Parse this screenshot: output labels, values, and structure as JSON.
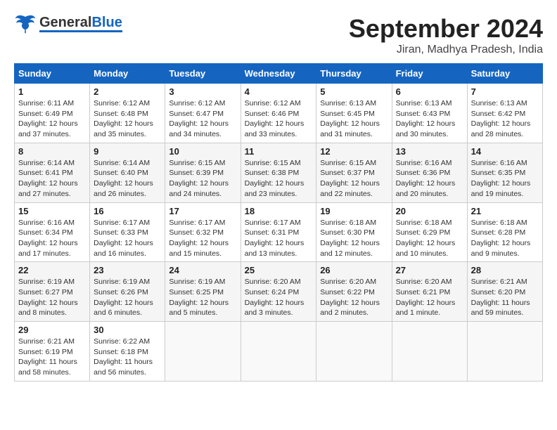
{
  "header": {
    "logo_general": "General",
    "logo_blue": "Blue",
    "title": "September 2024",
    "location": "Jiran, Madhya Pradesh, India"
  },
  "days_of_week": [
    "Sunday",
    "Monday",
    "Tuesday",
    "Wednesday",
    "Thursday",
    "Friday",
    "Saturday"
  ],
  "weeks": [
    [
      {
        "day": "1",
        "sunrise": "6:11 AM",
        "sunset": "6:49 PM",
        "daylight": "12 hours and 37 minutes."
      },
      {
        "day": "2",
        "sunrise": "6:12 AM",
        "sunset": "6:48 PM",
        "daylight": "12 hours and 35 minutes."
      },
      {
        "day": "3",
        "sunrise": "6:12 AM",
        "sunset": "6:47 PM",
        "daylight": "12 hours and 34 minutes."
      },
      {
        "day": "4",
        "sunrise": "6:12 AM",
        "sunset": "6:46 PM",
        "daylight": "12 hours and 33 minutes."
      },
      {
        "day": "5",
        "sunrise": "6:13 AM",
        "sunset": "6:45 PM",
        "daylight": "12 hours and 31 minutes."
      },
      {
        "day": "6",
        "sunrise": "6:13 AM",
        "sunset": "6:43 PM",
        "daylight": "12 hours and 30 minutes."
      },
      {
        "day": "7",
        "sunrise": "6:13 AM",
        "sunset": "6:42 PM",
        "daylight": "12 hours and 28 minutes."
      }
    ],
    [
      {
        "day": "8",
        "sunrise": "6:14 AM",
        "sunset": "6:41 PM",
        "daylight": "12 hours and 27 minutes."
      },
      {
        "day": "9",
        "sunrise": "6:14 AM",
        "sunset": "6:40 PM",
        "daylight": "12 hours and 26 minutes."
      },
      {
        "day": "10",
        "sunrise": "6:15 AM",
        "sunset": "6:39 PM",
        "daylight": "12 hours and 24 minutes."
      },
      {
        "day": "11",
        "sunrise": "6:15 AM",
        "sunset": "6:38 PM",
        "daylight": "12 hours and 23 minutes."
      },
      {
        "day": "12",
        "sunrise": "6:15 AM",
        "sunset": "6:37 PM",
        "daylight": "12 hours and 22 minutes."
      },
      {
        "day": "13",
        "sunrise": "6:16 AM",
        "sunset": "6:36 PM",
        "daylight": "12 hours and 20 minutes."
      },
      {
        "day": "14",
        "sunrise": "6:16 AM",
        "sunset": "6:35 PM",
        "daylight": "12 hours and 19 minutes."
      }
    ],
    [
      {
        "day": "15",
        "sunrise": "6:16 AM",
        "sunset": "6:34 PM",
        "daylight": "12 hours and 17 minutes."
      },
      {
        "day": "16",
        "sunrise": "6:17 AM",
        "sunset": "6:33 PM",
        "daylight": "12 hours and 16 minutes."
      },
      {
        "day": "17",
        "sunrise": "6:17 AM",
        "sunset": "6:32 PM",
        "daylight": "12 hours and 15 minutes."
      },
      {
        "day": "18",
        "sunrise": "6:17 AM",
        "sunset": "6:31 PM",
        "daylight": "12 hours and 13 minutes."
      },
      {
        "day": "19",
        "sunrise": "6:18 AM",
        "sunset": "6:30 PM",
        "daylight": "12 hours and 12 minutes."
      },
      {
        "day": "20",
        "sunrise": "6:18 AM",
        "sunset": "6:29 PM",
        "daylight": "12 hours and 10 minutes."
      },
      {
        "day": "21",
        "sunrise": "6:18 AM",
        "sunset": "6:28 PM",
        "daylight": "12 hours and 9 minutes."
      }
    ],
    [
      {
        "day": "22",
        "sunrise": "6:19 AM",
        "sunset": "6:27 PM",
        "daylight": "12 hours and 8 minutes."
      },
      {
        "day": "23",
        "sunrise": "6:19 AM",
        "sunset": "6:26 PM",
        "daylight": "12 hours and 6 minutes."
      },
      {
        "day": "24",
        "sunrise": "6:19 AM",
        "sunset": "6:25 PM",
        "daylight": "12 hours and 5 minutes."
      },
      {
        "day": "25",
        "sunrise": "6:20 AM",
        "sunset": "6:24 PM",
        "daylight": "12 hours and 3 minutes."
      },
      {
        "day": "26",
        "sunrise": "6:20 AM",
        "sunset": "6:22 PM",
        "daylight": "12 hours and 2 minutes."
      },
      {
        "day": "27",
        "sunrise": "6:20 AM",
        "sunset": "6:21 PM",
        "daylight": "12 hours and 1 minute."
      },
      {
        "day": "28",
        "sunrise": "6:21 AM",
        "sunset": "6:20 PM",
        "daylight": "11 hours and 59 minutes."
      }
    ],
    [
      {
        "day": "29",
        "sunrise": "6:21 AM",
        "sunset": "6:19 PM",
        "daylight": "11 hours and 58 minutes."
      },
      {
        "day": "30",
        "sunrise": "6:22 AM",
        "sunset": "6:18 PM",
        "daylight": "11 hours and 56 minutes."
      },
      null,
      null,
      null,
      null,
      null
    ]
  ]
}
